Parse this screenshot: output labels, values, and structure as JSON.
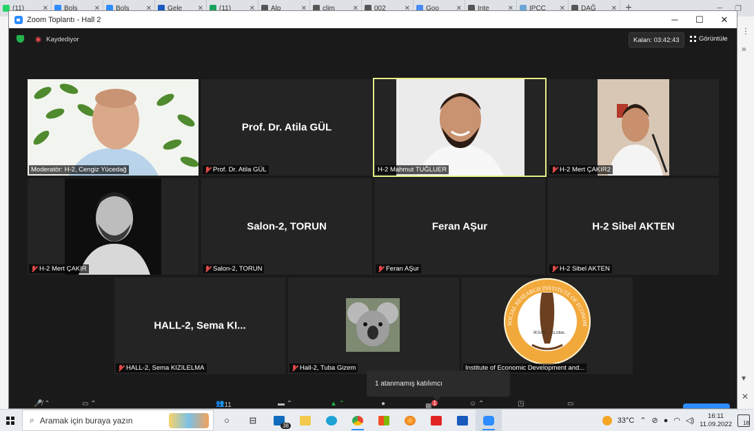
{
  "browser": {
    "tabs": [
      {
        "label": "(11)",
        "color": "#25d366"
      },
      {
        "label": "Bols",
        "color": "#2d8cff"
      },
      {
        "label": "Bols",
        "color": "#2d8cff"
      },
      {
        "label": "Gele",
        "color": "#185abd"
      },
      {
        "label": "(11)",
        "color": "#1aa260"
      },
      {
        "label": "Alp",
        "color": "#555555"
      },
      {
        "label": "clim",
        "color": "#555555"
      },
      {
        "label": "002",
        "color": "#555555"
      },
      {
        "label": "Goo",
        "color": "#4a8af4"
      },
      {
        "label": "Inte",
        "color": "#555555"
      },
      {
        "label": "IPCC",
        "color": "#6ba5d8"
      },
      {
        "label": "DAĞ",
        "color": "#555555"
      }
    ],
    "new_tab": "+"
  },
  "window": {
    "title": "Zoom Toplantı - Hall 2"
  },
  "topbar": {
    "recording": "Kaydediyor",
    "timer": "Kalan: 03:42:43",
    "view": "Görüntüle"
  },
  "tiles": [
    {
      "label": "Moderatör: H-2, Cengiz Yücedağ",
      "name": "",
      "active": false,
      "muted": false,
      "photo": "bald-man-plant-background"
    },
    {
      "label": "Prof. Dr. Atila GÜL",
      "name": "Prof. Dr. Atila GÜL",
      "active": false,
      "muted": true
    },
    {
      "label": "H-2 Mahmut TUĞLUER",
      "name": "",
      "active": true,
      "muted": false,
      "photo": "smiling-bearded-man"
    },
    {
      "label": "H-2 Mert ÇAKIR2",
      "name": "",
      "active": false,
      "muted": true,
      "photo": "man-at-desk"
    },
    {
      "label": "H-2 Mert ÇAKIR",
      "name": "",
      "active": false,
      "muted": true,
      "photo": "bw-portrait"
    },
    {
      "label": "Salon-2, TORUN",
      "name": "Salon-2, TORUN",
      "active": false,
      "muted": true
    },
    {
      "label": "Feran AŞur",
      "name": "Feran AŞur",
      "active": false,
      "muted": true
    },
    {
      "label": "H-2 Sibel AKTEN",
      "name": "H-2 Sibel AKTEN",
      "active": false,
      "muted": true
    },
    {
      "label": "HALL-2, Sema KIZILELMA",
      "name": "HALL-2, Sema KI...",
      "active": false,
      "muted": true
    },
    {
      "label": "Hall-2, Tuba Gizem",
      "name": "",
      "active": false,
      "muted": true,
      "photo": "koala"
    },
    {
      "label": "Institute of Economic Development and...",
      "name": "",
      "active": false,
      "muted": false,
      "photo": "institute-logo"
    }
  ],
  "logo_text": {
    "ring": "SOCIAL RESEARCH INSTITUTE OF ECONOMIC DEVELOPMENT AND",
    "left": "İKSAD",
    "right": "GLOBAL"
  },
  "tooltip": "1 atanmamış katılımcı",
  "toolbar": {
    "participants_count": "11",
    "breakout_badge": "1"
  },
  "taskbar": {
    "search_placeholder": "Aramak için buraya yazın",
    "mail_badge": "38",
    "weather": "33°C",
    "time": "16:11",
    "date": "11.09.2022",
    "notif_count": "18"
  }
}
